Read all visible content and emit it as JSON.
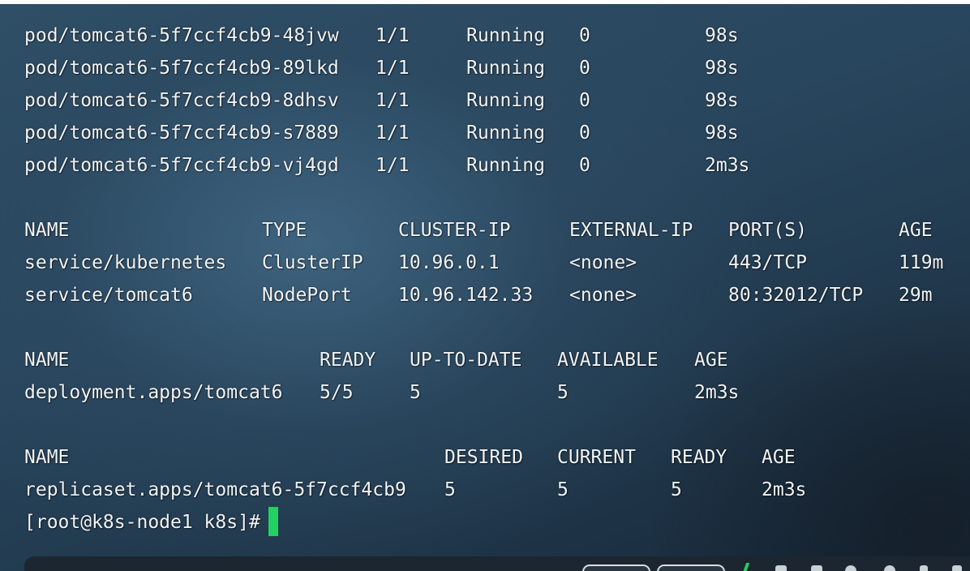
{
  "pods": [
    {
      "name": "pod/tomcat6-5f7ccf4cb9-48jvw",
      "ready": "1/1",
      "status": "Running",
      "restarts": "0",
      "age": "98s"
    },
    {
      "name": "pod/tomcat6-5f7ccf4cb9-89lkd",
      "ready": "1/1",
      "status": "Running",
      "restarts": "0",
      "age": "98s"
    },
    {
      "name": "pod/tomcat6-5f7ccf4cb9-8dhsv",
      "ready": "1/1",
      "status": "Running",
      "restarts": "0",
      "age": "98s"
    },
    {
      "name": "pod/tomcat6-5f7ccf4cb9-s7889",
      "ready": "1/1",
      "status": "Running",
      "restarts": "0",
      "age": "98s"
    },
    {
      "name": "pod/tomcat6-5f7ccf4cb9-vj4gd",
      "ready": "1/1",
      "status": "Running",
      "restarts": "0",
      "age": "2m3s"
    }
  ],
  "services": {
    "headers": [
      "NAME",
      "TYPE",
      "CLUSTER-IP",
      "EXTERNAL-IP",
      "PORT(S)",
      "AGE"
    ],
    "rows": [
      [
        "service/kubernetes",
        "ClusterIP",
        "10.96.0.1",
        "<none>",
        "443/TCP",
        "119m"
      ],
      [
        "service/tomcat6",
        "NodePort",
        "10.96.142.33",
        "<none>",
        "80:32012/TCP",
        "29m"
      ]
    ]
  },
  "deployments": {
    "headers": [
      "NAME",
      "READY",
      "UP-TO-DATE",
      "AVAILABLE",
      "AGE"
    ],
    "rows": [
      [
        "deployment.apps/tomcat6",
        "5/5",
        "5",
        "5",
        "2m3s"
      ]
    ]
  },
  "replicasets": {
    "headers": [
      "NAME",
      "DESIRED",
      "CURRENT",
      "READY",
      "AGE"
    ],
    "rows": [
      [
        "replicaset.apps/tomcat6-5f7ccf4cb9",
        "5",
        "5",
        "5",
        "2m3s"
      ]
    ]
  },
  "prompt": "[root@k8s-node1 k8s]#",
  "colors": {
    "cursor": "#22d160",
    "text": "#f2f4f6"
  },
  "bottom_bar": {
    "icons": [
      "tab-button",
      "tab-button",
      "signal-icon",
      "tag-icon",
      "clipboard-icon",
      "search-icon",
      "gear-icon",
      "lock-icon"
    ]
  }
}
